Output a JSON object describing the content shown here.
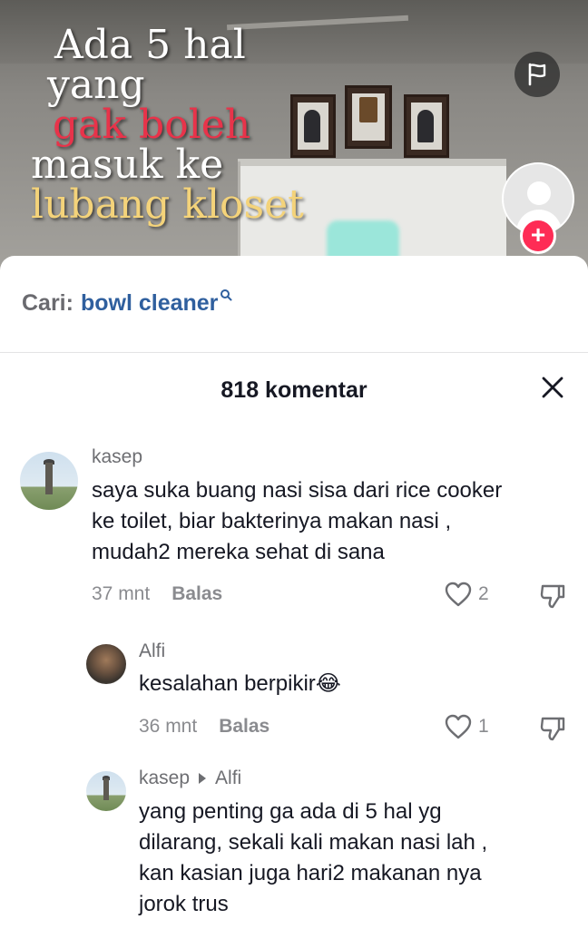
{
  "video": {
    "overlay_lines": [
      "Ada 5 hal",
      "yang",
      "gak boleh",
      "masuk ke",
      "lubang kloset"
    ],
    "report_icon": "flag-icon",
    "creator_avatar_icon": "user-avatar-icon",
    "follow_icon": "plus-icon",
    "colors": {
      "overlay_red": "#e8334a",
      "overlay_gold": "#f4d37a",
      "follow": "#fe2c55"
    }
  },
  "search": {
    "prefix": "Cari:",
    "term": "bowl cleaner",
    "icon": "search-icon"
  },
  "comments_header": {
    "count_label": "818 komentar",
    "close_icon": "close-icon"
  },
  "comments": [
    {
      "user": "kasep",
      "text_lines": [
        "saya suka buang nasi sisa dari rice cooker",
        "ke toilet, biar bakterinya makan nasi ,",
        "mudah2 mereka sehat di sana"
      ],
      "time": "37 mnt",
      "reply_label": "Balas",
      "likes": "2"
    },
    {
      "user": "Alfi",
      "text_lines": [
        "kesalahan berpikir😂"
      ],
      "time": "36 mnt",
      "reply_label": "Balas",
      "likes": "1"
    },
    {
      "user": "kasep",
      "reply_to": "Alfi",
      "text_lines": [
        "yang penting ga ada di 5 hal yg",
        "dilarang, sekali kali makan nasi lah ,",
        "kan kasian juga hari2 makanan nya",
        "jorok trus"
      ]
    }
  ],
  "accent_colors": {
    "search_term": "#2f5f9e",
    "text": "#161823",
    "muted": "#8a8b8f"
  }
}
